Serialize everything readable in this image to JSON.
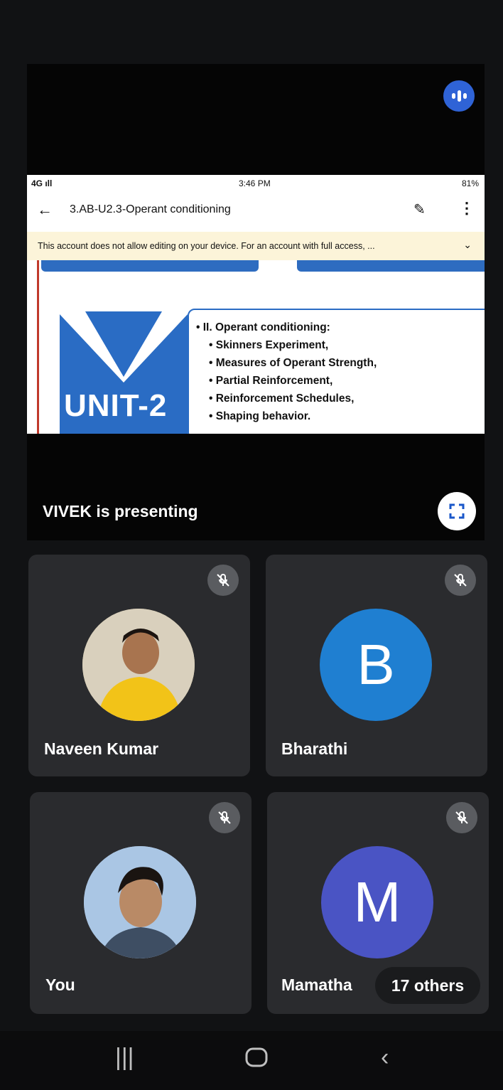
{
  "meeting": {
    "presenting_text": "VIVEK is presenting",
    "others_label": "17 others"
  },
  "shared_screen": {
    "status_left": "4G ıll",
    "status_time": "3:46 PM",
    "status_right": "81%",
    "doc_title": "3.AB-U2.3-Operant conditioning",
    "warning": "This account does not allow editing on your device. For an account with full access, ...",
    "slide": {
      "unit": "UNIT-2",
      "heading": "II. Operant conditioning:",
      "bullets": [
        "Skinners Experiment,",
        "Measures of Operant Strength,",
        "Partial Reinforcement,",
        "Reinforcement Schedules,",
        "Shaping behavior."
      ]
    }
  },
  "participants": [
    {
      "name": "Naveen Kumar",
      "initial": ""
    },
    {
      "name": "Bharathi",
      "initial": "B",
      "color": "#1f7fd1"
    },
    {
      "name": "You",
      "initial": ""
    },
    {
      "name": "Mamatha",
      "initial": "M",
      "color": "#4a54c4"
    }
  ]
}
